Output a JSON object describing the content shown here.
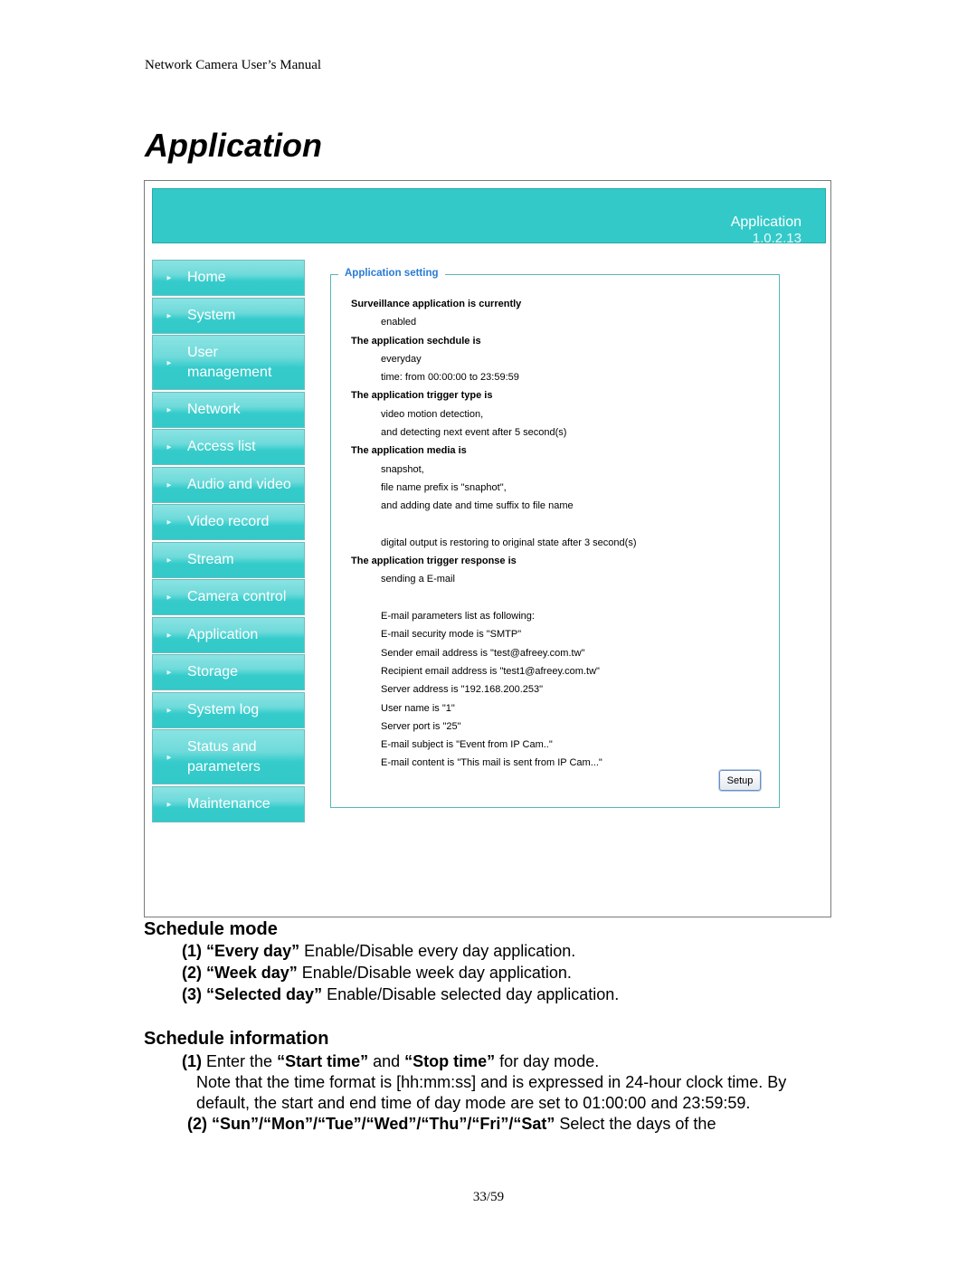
{
  "document": {
    "running_header": "Network Camera User’s Manual",
    "heading": "Application",
    "page_number": "33/59"
  },
  "screenshot": {
    "banner": {
      "title": "Application",
      "version": "1.0.2.13",
      "color": "#33c9c9"
    },
    "nav": {
      "arrow_icon": "triangle-right-icon",
      "items": [
        {
          "label": "Home"
        },
        {
          "label": "System"
        },
        {
          "label": "User management"
        },
        {
          "label": "Network"
        },
        {
          "label": "Access list"
        },
        {
          "label": "Audio and video"
        },
        {
          "label": "Video record"
        },
        {
          "label": "Stream"
        },
        {
          "label": "Camera control"
        },
        {
          "label": "Application"
        },
        {
          "label": "Storage"
        },
        {
          "label": "System log"
        },
        {
          "label": "Status and parameters"
        },
        {
          "label": "Maintenance"
        }
      ]
    },
    "panel": {
      "legend": "Application setting",
      "lines": [
        {
          "text": "Surveillance application is currently",
          "style": "bold"
        },
        {
          "text": "enabled",
          "style": "indent"
        },
        {
          "text": "The application sechdule is",
          "style": "bold"
        },
        {
          "text": "everyday",
          "style": "indent"
        },
        {
          "text": "time: from 00:00:00 to 23:59:59",
          "style": "indent"
        },
        {
          "text": "The application trigger type is",
          "style": "bold"
        },
        {
          "text": "video motion detection,",
          "style": "indent"
        },
        {
          "text": "and detecting next event after 5 second(s)",
          "style": "indent"
        },
        {
          "text": "The application media is",
          "style": "bold"
        },
        {
          "text": "snapshot,",
          "style": "indent"
        },
        {
          "text": "file name prefix is \"snaphot\",",
          "style": "indent"
        },
        {
          "text": "and adding date and time suffix to file name",
          "style": "indent"
        },
        {
          "text": "",
          "style": "indent"
        },
        {
          "text": "digital output is restoring to original state after 3 second(s)",
          "style": "indent"
        },
        {
          "text": "The application trigger response is",
          "style": "bold"
        },
        {
          "text": "sending a E-mail",
          "style": "indent"
        },
        {
          "text": "",
          "style": "indent"
        },
        {
          "text": "E-mail parameters list as following:",
          "style": "indent"
        },
        {
          "text": "E-mail security mode is \"SMTP\"",
          "style": "indent"
        },
        {
          "text": "Sender email address is \"test@afreey.com.tw\"",
          "style": "indent"
        },
        {
          "text": "Recipient email address is \"test1@afreey.com.tw\"",
          "style": "indent"
        },
        {
          "text": "Server address is \"192.168.200.253\"",
          "style": "indent"
        },
        {
          "text": "User name is \"1\"",
          "style": "indent"
        },
        {
          "text": "Server port is \"25\"",
          "style": "indent"
        },
        {
          "text": "E-mail subject is \"Event from IP Cam..\"",
          "style": "indent"
        },
        {
          "text": "E-mail content is \"This mail is sent from IP Cam...\"",
          "style": "indent"
        }
      ],
      "setup_button": "Setup"
    }
  },
  "schedule_mode": {
    "title": "Schedule mode",
    "items": [
      {
        "num": "(1)",
        "term": "“Every day”",
        "desc": " Enable/Disable every day application."
      },
      {
        "num": "(2)",
        "term": "“Week day”",
        "desc": " Enable/Disable week day application."
      },
      {
        "num": "(3)",
        "term": "“Selected day”",
        "desc": " Enable/Disable selected day application."
      }
    ]
  },
  "schedule_information": {
    "title": "Schedule information",
    "item1": {
      "num": "(1)",
      "pre": " Enter the ",
      "term1": "“Start time”",
      "mid": " and ",
      "term2": "“Stop time”",
      "post": " for day mode.",
      "note_line1": "Note that the time format is [hh:mm:ss] and is expressed in 24-hour clock time. By",
      "note_line2": "default, the start and end time of day mode are set to 01:00:00 and 23:59:59."
    },
    "item2": {
      "num": "(2)",
      "terms": "“Sun”/“Mon”/“Tue”/“Wed”/“Thu”/“Fri”/“Sat”",
      "desc": " Select the days of the"
    }
  }
}
